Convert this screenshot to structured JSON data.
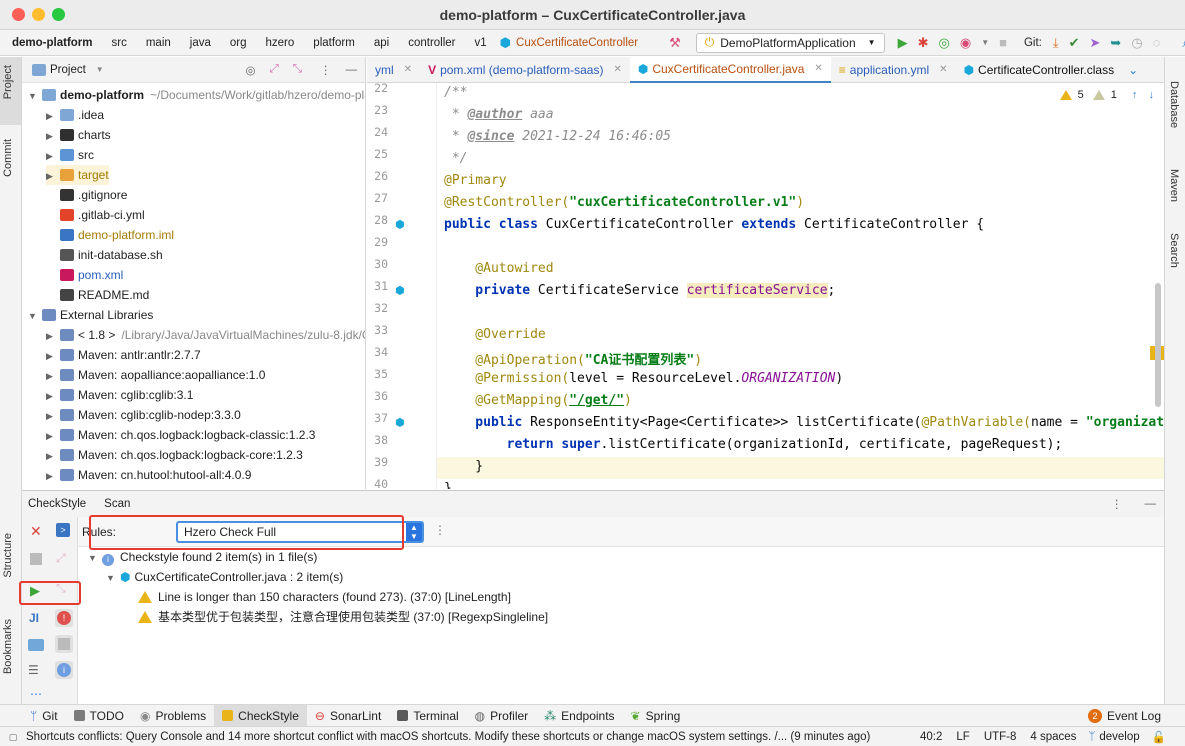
{
  "window": {
    "title": "demo-platform – CuxCertificateController.java"
  },
  "navbar": {
    "breadcrumbs": [
      "demo-platform",
      "src",
      "main",
      "java",
      "org",
      "hzero",
      "platform",
      "api",
      "controller",
      "v1"
    ],
    "current_class": "CuxCertificateController",
    "run_config": "DemoPlatformApplication",
    "git_label": "Git:"
  },
  "left_strip": {
    "tabs": [
      "Project",
      "Commit",
      "Structure",
      "Bookmarks"
    ]
  },
  "right_strip": {
    "tabs": [
      "Database",
      "Maven",
      "Search"
    ]
  },
  "project_panel": {
    "title": "Project",
    "tree": [
      {
        "indent": 0,
        "arrow": "down",
        "icon": "folder",
        "label": "demo-platform",
        "extra": "~/Documents/Work/gitlab/hzero/demo-plat",
        "bold": true
      },
      {
        "indent": 1,
        "arrow": "right",
        "icon": "folder",
        "label": ".idea"
      },
      {
        "indent": 1,
        "arrow": "right",
        "icon": "folder-dark",
        "label": "charts"
      },
      {
        "indent": 1,
        "arrow": "right",
        "icon": "folder-src",
        "label": "src"
      },
      {
        "indent": 1,
        "arrow": "right",
        "icon": "folder-excluded",
        "label": "target",
        "color": "#a37c00"
      },
      {
        "indent": 1,
        "arrow": "",
        "icon": "git",
        "label": ".gitignore"
      },
      {
        "indent": 1,
        "arrow": "",
        "icon": "gitlab",
        "label": ".gitlab-ci.yml"
      },
      {
        "indent": 1,
        "arrow": "",
        "icon": "iml",
        "label": "demo-platform.iml",
        "color": "#a37c00"
      },
      {
        "indent": 1,
        "arrow": "",
        "icon": "shell",
        "label": "init-database.sh"
      },
      {
        "indent": 1,
        "arrow": "",
        "icon": "maven",
        "label": "pom.xml",
        "color": "#2a5dbb"
      },
      {
        "indent": 1,
        "arrow": "",
        "icon": "md",
        "label": "README.md"
      },
      {
        "indent": 0,
        "arrow": "down",
        "icon": "library",
        "label": "External Libraries"
      },
      {
        "indent": 1,
        "arrow": "right",
        "icon": "jdk",
        "label": "< 1.8 >",
        "extra": "/Library/Java/JavaVirtualMachines/zulu-8.jdk/Co"
      },
      {
        "indent": 1,
        "arrow": "right",
        "icon": "library",
        "label": "Maven: antlr:antlr:2.7.7"
      },
      {
        "indent": 1,
        "arrow": "right",
        "icon": "library",
        "label": "Maven: aopalliance:aopalliance:1.0"
      },
      {
        "indent": 1,
        "arrow": "right",
        "icon": "library",
        "label": "Maven: cglib:cglib:3.1"
      },
      {
        "indent": 1,
        "arrow": "right",
        "icon": "library",
        "label": "Maven: cglib:cglib-nodep:3.3.0"
      },
      {
        "indent": 1,
        "arrow": "right",
        "icon": "library",
        "label": "Maven: ch.qos.logback:logback-classic:1.2.3"
      },
      {
        "indent": 1,
        "arrow": "right",
        "icon": "library",
        "label": "Maven: ch.qos.logback:logback-core:1.2.3"
      },
      {
        "indent": 1,
        "arrow": "right",
        "icon": "library",
        "label": "Maven: cn.hutool:hutool-all:4.0.9"
      }
    ]
  },
  "editor": {
    "tabs": [
      {
        "label": "yml",
        "active": false
      },
      {
        "label": "pom.xml (demo-platform-saas)",
        "active": false
      },
      {
        "label": "CuxCertificateController.java",
        "active": true
      },
      {
        "label": "application.yml",
        "active": false
      },
      {
        "label": "CertificateController.class",
        "active": false
      }
    ],
    "warnings_count": "5",
    "weak_warnings_count": "1",
    "line_numbers": [
      "22",
      "23",
      "24",
      "25",
      "26",
      "27",
      "28",
      "29",
      "30",
      "31",
      "32",
      "33",
      "34",
      "35",
      "36",
      "37",
      "38",
      "39",
      "40"
    ],
    "code": {
      "l22": "/**",
      "l23_tag": "@author",
      "l23_val": " aaa",
      "l24_tag": "@since",
      "l24_val": " 2021-12-24 16:46:05",
      "l25": " */",
      "l26": "@Primary",
      "l27_ann": "@RestController(",
      "l27_str": "\"cuxCertificateController.v1\"",
      "l27_end": ")",
      "l28_kw1": "public class ",
      "l28_name": "CuxCertificateController ",
      "l28_kw2": "extends ",
      "l28_sup": "CertificateController ",
      "l28_brace": "{",
      "l30": "@Autowired",
      "l31_kw": "private ",
      "l31_type": "CertificateService ",
      "l31_fld": "certificateService",
      "l31_end": ";",
      "l33": "@Override",
      "l34_ann": "@ApiOperation(",
      "l34_str": "\"CA证书配置列表\"",
      "l34_end": ")",
      "l35_ann": "@Permission(",
      "l35_mid": "level = ResourceLevel.",
      "l35_const": "ORGANIZATION",
      "l35_end": ")",
      "l36_ann": "@GetMapping(",
      "l36_url": "\"/get/\"",
      "l36_end": ")",
      "l37_kw": "public ",
      "l37_type": "ResponseEntity<Page<Certificate>> listCertificate(",
      "l37_ann": "@PathVariable(",
      "l37_mid": "name = ",
      "l37_str": "\"organizat",
      "l38_kw1": "return ",
      "l38_kw2": "super",
      "l38_rest": ".listCertificate(organizationId, certificate, pageRequest);",
      "l39": "}",
      "l40": "}"
    }
  },
  "bottom_panel": {
    "tabs": [
      "CheckStyle",
      "Scan"
    ],
    "rules_label": "Rules:",
    "rules_selected": "Hzero Check Full",
    "summary": "Checkstyle found 2 item(s) in 1 file(s)",
    "file": "CuxCertificateController.java : 2 item(s)",
    "items": [
      "Line is longer than 150 characters (found 273). (37:0) [LineLength]",
      "基本类型优于包装类型，注意合理使用包装类型 (37:0) [RegexpSingleline]"
    ]
  },
  "tool_windows": [
    "Git",
    "TODO",
    "Problems",
    "CheckStyle",
    "SonarLint",
    "Terminal",
    "Profiler",
    "Endpoints",
    "Spring"
  ],
  "event_log": {
    "count": "2",
    "label": "Event Log"
  },
  "status_bar": {
    "message": "Shortcuts conflicts: Query Console and 14 more shortcut conflict with macOS shortcuts. Modify these shortcuts or change macOS system settings. /... (9 minutes ago)",
    "position": "40:2",
    "line_sep": "LF",
    "encoding": "UTF-8",
    "indent": "4 spaces",
    "branch": "develop"
  }
}
